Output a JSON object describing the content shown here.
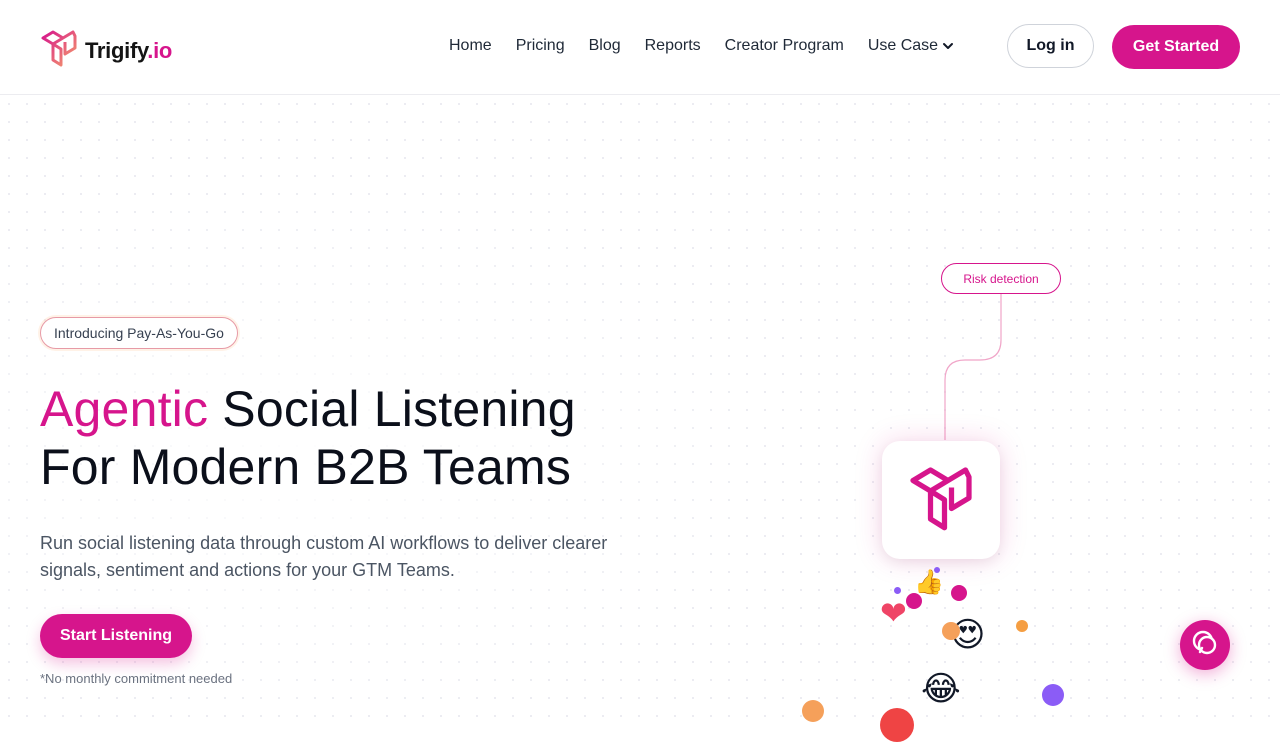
{
  "header": {
    "logo_text": "Trigify",
    "logo_tld": ".io",
    "nav": [
      {
        "label": "Home"
      },
      {
        "label": "Pricing"
      },
      {
        "label": "Blog"
      },
      {
        "label": "Reports"
      },
      {
        "label": "Creator Program"
      },
      {
        "label": "Use Case"
      }
    ],
    "login_label": "Log in",
    "get_started_label": "Get Started"
  },
  "hero": {
    "badge": "Introducing Pay-As-You-Go",
    "title_accent": "Agentic",
    "title_rest_line1": "Social Listening",
    "title_line2": "For Modern B2B Teams",
    "subtitle": "Run social listening data through custom AI workflows to deliver clearer signals, sentiment and actions for your GTM Teams.",
    "cta_label": "Start Listening",
    "cta_note": "*No monthly commitment needed"
  },
  "illustration": {
    "tag": "Risk detection",
    "icons": [
      "trigify-logo-icon",
      "thumbs-up-icon",
      "heart-icon",
      "heart-eyes-emoji-icon",
      "laughing-emoji-icon"
    ]
  },
  "colors": {
    "brand": "#d6158c",
    "accent_orange": "#f5a05a",
    "text_dark": "#0b0f1a"
  },
  "chat": {
    "icon": "chat-bubble-icon"
  }
}
